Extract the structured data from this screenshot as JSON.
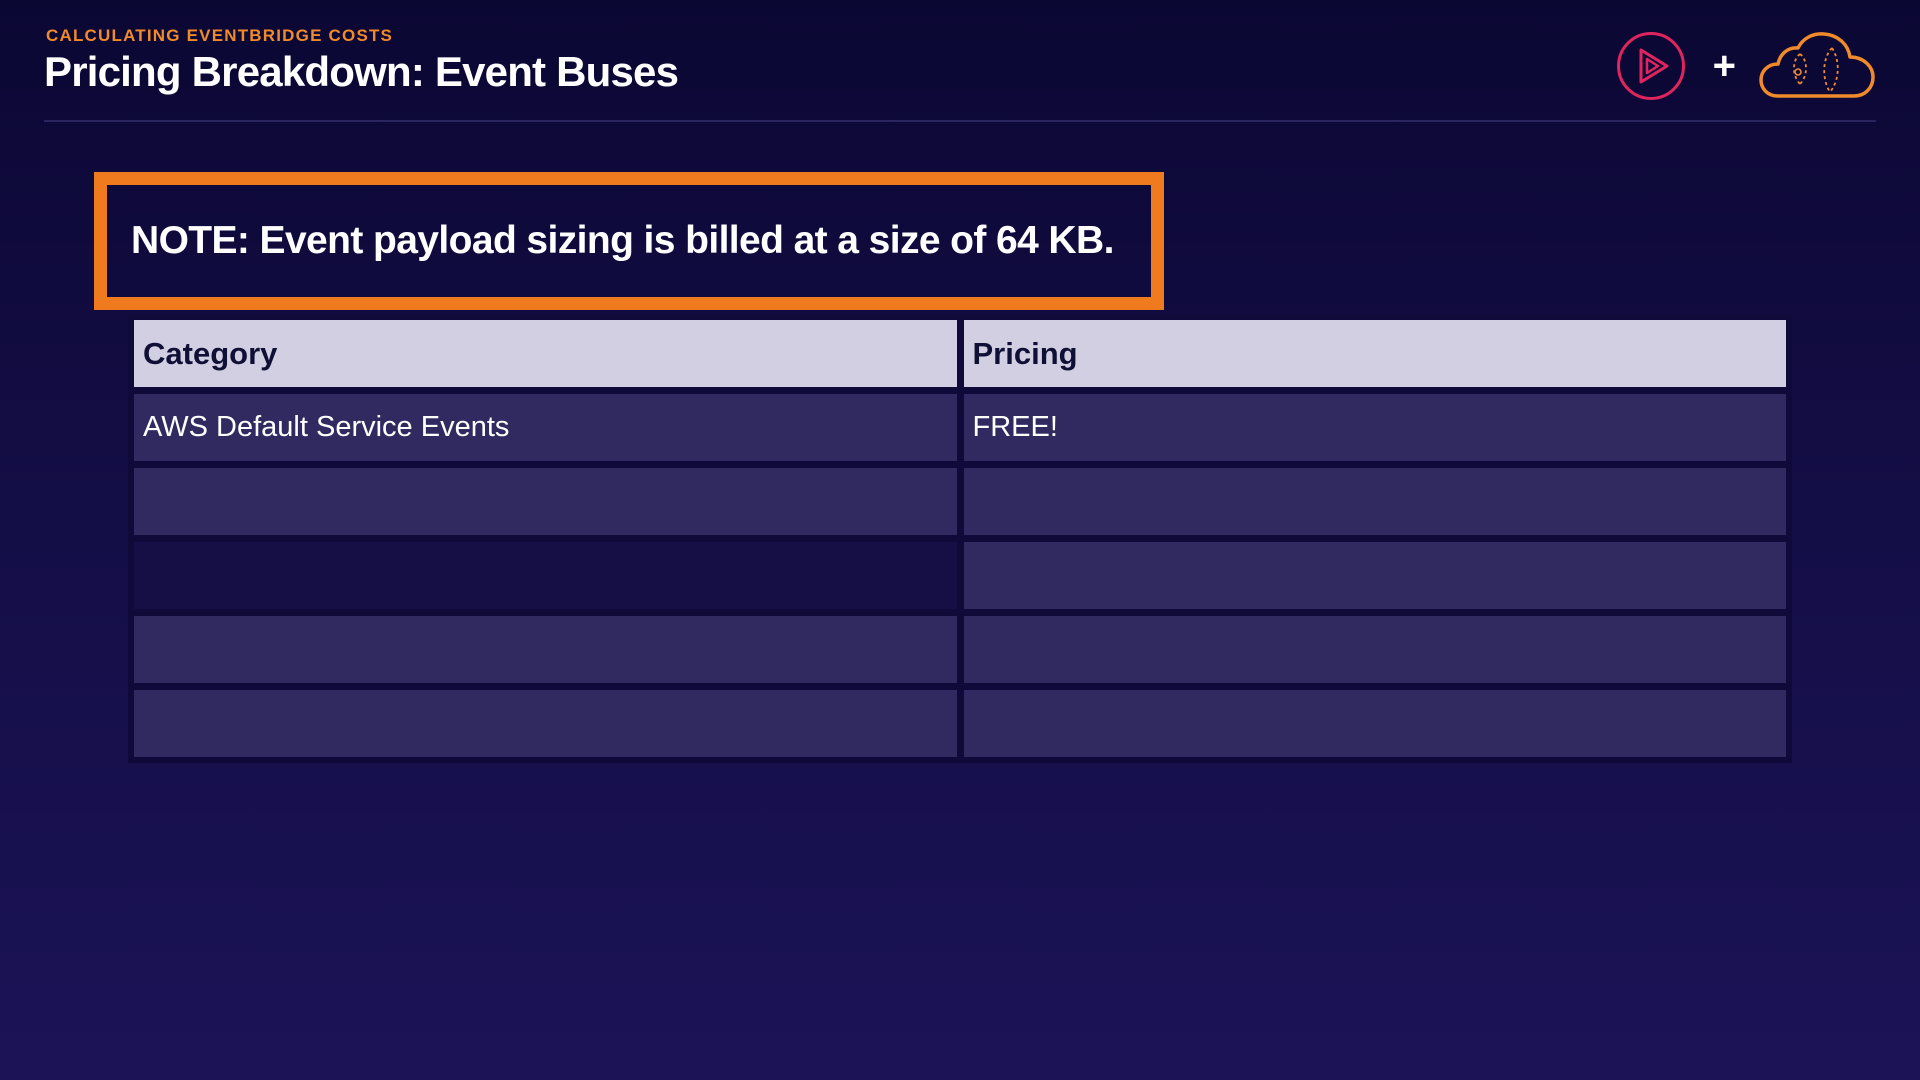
{
  "header": {
    "eyebrow": "CALCULATING EVENTBRIDGE COSTS",
    "title": "Pricing Breakdown: Event Buses",
    "plus": "+"
  },
  "brand": {
    "play_icon": "play-circle-icon",
    "cloud_icon": "cloud-icon",
    "play_color": "#e0245e",
    "cloud_color": "#f08a2b"
  },
  "note": {
    "text": "NOTE: Event payload sizing is billed at a size of 64 KB.",
    "border_color": "#f07a1e"
  },
  "table": {
    "headers": [
      "Category",
      "Pricing"
    ],
    "rows": [
      [
        "AWS Default Service Events",
        "FREE!"
      ],
      [
        "",
        ""
      ],
      [
        "",
        ""
      ],
      [
        "",
        ""
      ],
      [
        "",
        ""
      ]
    ]
  }
}
